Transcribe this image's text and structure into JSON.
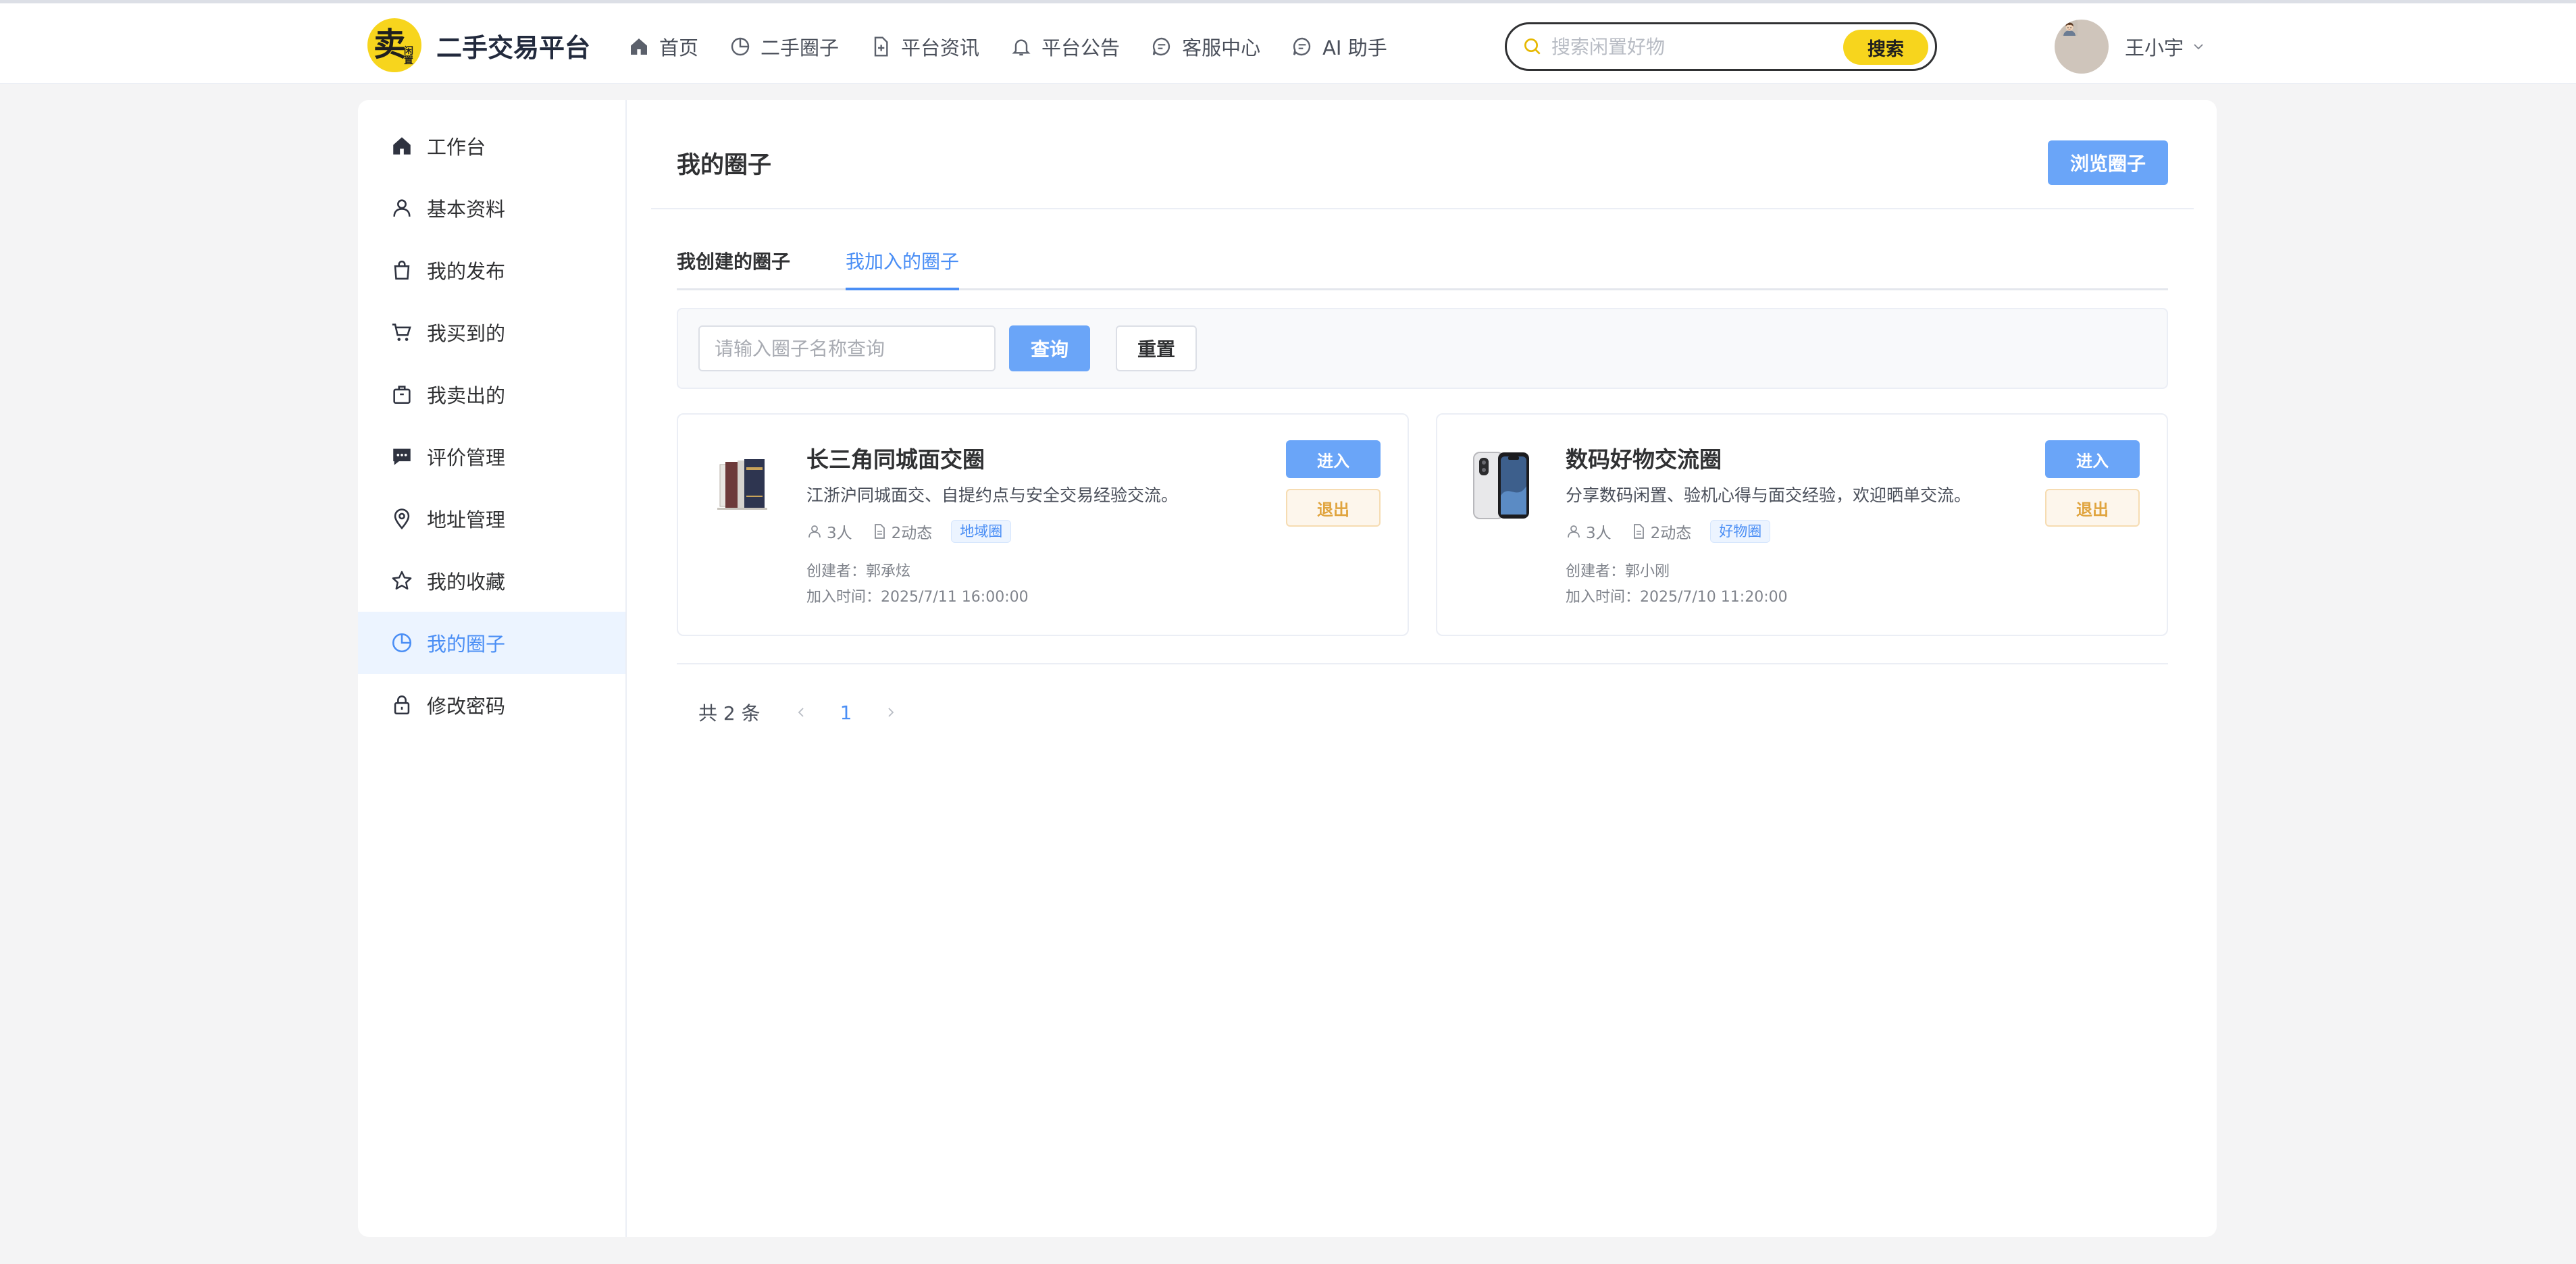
{
  "brand": {
    "logo_char": "卖",
    "logo_small": "闲置",
    "name": "二手交易平台"
  },
  "nav": [
    {
      "label": "首页",
      "icon": "home-icon"
    },
    {
      "label": "二手圈子",
      "icon": "pie-chart-icon"
    },
    {
      "label": "平台资讯",
      "icon": "document-add-icon"
    },
    {
      "label": "平台公告",
      "icon": "bell-icon"
    },
    {
      "label": "客服中心",
      "icon": "chat-icon"
    },
    {
      "label": "AI 助手",
      "icon": "chat-icon"
    }
  ],
  "search": {
    "placeholder": "搜索闲置好物",
    "button": "搜索"
  },
  "user": {
    "name": "王小宇"
  },
  "sidebar": {
    "items": [
      {
        "label": "工作台",
        "icon": "home-icon"
      },
      {
        "label": "基本资料",
        "icon": "user-icon"
      },
      {
        "label": "我的发布",
        "icon": "shopping-bag-icon"
      },
      {
        "label": "我买到的",
        "icon": "cart-icon"
      },
      {
        "label": "我卖出的",
        "icon": "box-icon"
      },
      {
        "label": "评价管理",
        "icon": "comment-icon"
      },
      {
        "label": "地址管理",
        "icon": "location-icon"
      },
      {
        "label": "我的收藏",
        "icon": "star-icon"
      },
      {
        "label": "我的圈子",
        "icon": "pie-chart-icon",
        "active": true
      },
      {
        "label": "修改密码",
        "icon": "lock-icon"
      }
    ]
  },
  "main": {
    "title": "我的圈子",
    "browse_button": "浏览圈子",
    "tabs": [
      {
        "label": "我创建的圈子"
      },
      {
        "label": "我加入的圈子",
        "active": true
      }
    ],
    "filter": {
      "placeholder": "请输入圈子名称查询",
      "query_button": "查询",
      "reset_button": "重置"
    },
    "circles": [
      {
        "name": "长三角同城面交圈",
        "description": "江浙沪同城面交、自提约点与安全交易经验交流。",
        "members": "3人",
        "posts": "2动态",
        "tag": "地域圈",
        "creator": "创建者：郭承炫",
        "joined_at": "加入时间：2025/7/11 16:00:00",
        "enter_button": "进入",
        "exit_button": "退出",
        "thumb_icon": "books-icon"
      },
      {
        "name": "数码好物交流圈",
        "description": "分享数码闲置、验机心得与面交经验，欢迎晒单交流。",
        "members": "3人",
        "posts": "2动态",
        "tag": "好物圈",
        "creator": "创建者：郭小刚",
        "joined_at": "加入时间：2025/7/10 11:20:00",
        "enter_button": "进入",
        "exit_button": "退出",
        "thumb_icon": "phone-icon"
      }
    ],
    "pagination": {
      "total": "共 2 条",
      "current_page": "1"
    }
  },
  "colors": {
    "accent": "#4a8ef5",
    "primary_button": "#6aa5f8",
    "brand_yellow": "#f7d51d",
    "warning_text": "#e0a43e"
  }
}
